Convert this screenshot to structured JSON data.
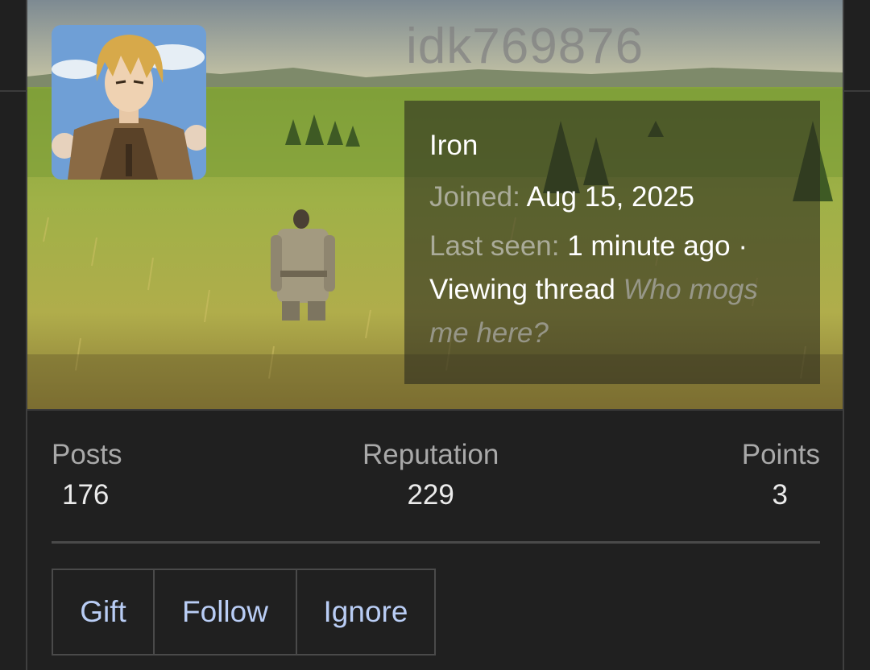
{
  "profile": {
    "username": "idk769876",
    "rank": "Iron",
    "joined_label": "Joined:",
    "joined_value": "Aug 15, 2025",
    "last_seen_label": "Last seen:",
    "last_seen_value": "1 minute ago ·",
    "activity_prefix": "Viewing thread",
    "activity_thread": "Who mogs me here?"
  },
  "stats": {
    "posts_label": "Posts",
    "posts_value": "176",
    "reputation_label": "Reputation",
    "reputation_value": "229",
    "points_label": "Points",
    "points_value": "3"
  },
  "actions": {
    "gift": "Gift",
    "follow": "Follow",
    "ignore": "Ignore"
  },
  "colors": {
    "background": "#202020",
    "link": "#b9cdf5",
    "divider": "#4a4a4a"
  },
  "icons": {
    "banner": "meadow-banner-image",
    "avatar": "anime-character-avatar"
  }
}
